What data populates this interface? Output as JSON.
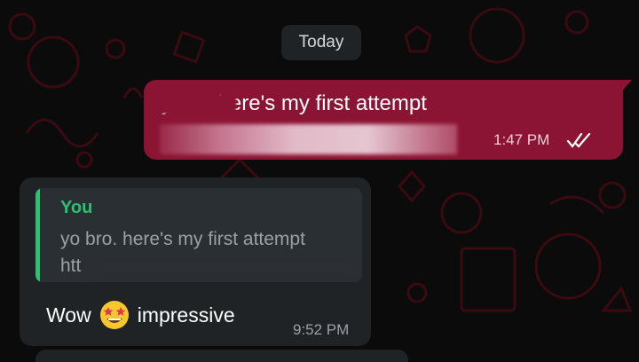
{
  "chat": {
    "date_chip": "Today",
    "sent_message": {
      "text_visible": "y... o. here's my first attempt",
      "time": "1:47 PM",
      "status": "read"
    },
    "received_message": {
      "quoted_author": "You",
      "quoted_text": "yo bro. here's my first attempt",
      "quoted_link_visible": "htt",
      "reply_before_emoji": "Wow",
      "emoji": "star-struck-emoji",
      "reply_after_emoji": "impressive",
      "time": "9:52 PM"
    }
  },
  "colors": {
    "background": "#0b0b0b",
    "wallpaper_doodles": "#3a0a12",
    "sent_bubble": "#8b1434",
    "received_bubble": "#1f2326",
    "quote_accent": "#2fbf71",
    "read_ticks": "#ffffff"
  }
}
